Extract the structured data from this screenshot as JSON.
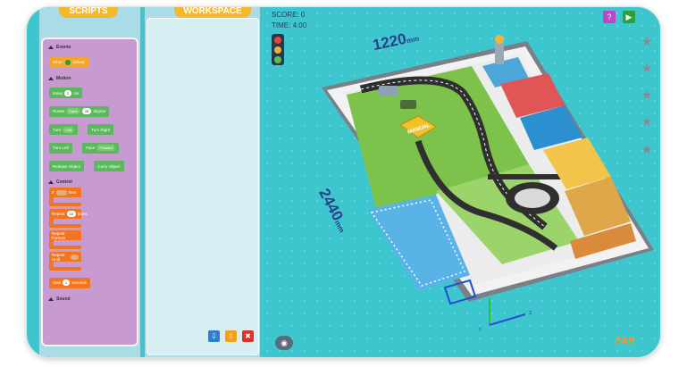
{
  "tabs": {
    "scripts": "SCRIPTS",
    "workspace": "WORKSPACE"
  },
  "palette": {
    "events": {
      "title": "Events",
      "when_clicked": {
        "pre": "When",
        "post": "clicked"
      }
    },
    "motion": {
      "title": "Motion",
      "move": {
        "label": "Move",
        "value": "2",
        "unit": "ms"
      },
      "rotate": {
        "label": "Rotate",
        "dir": "Earth",
        "value": "25",
        "unit": "degree"
      },
      "turn": {
        "label": "Turn",
        "dir": "Left"
      },
      "turn_right": "Turn Right",
      "turn_left": "Turn Left",
      "face": {
        "label": "Face",
        "dir": "Forward"
      },
      "release": "Release Object",
      "carry": "Carry Object"
    },
    "control": {
      "title": "Control",
      "if": {
        "pre": "If",
        "post": "then"
      },
      "repeat": {
        "label": "Repeat",
        "value": "10",
        "unit": "times"
      },
      "repeat_forever": "Repeat Forever",
      "repeat_until": "Repeat Until",
      "wait": {
        "label": "Wait",
        "value": "1",
        "unit": "seconds"
      }
    },
    "sound": {
      "title": "Sound"
    }
  },
  "hud": {
    "score_label": "SCORE:",
    "score": "0",
    "time_label": "TIME:",
    "time": "4:00"
  },
  "board": {
    "width_value": "1220",
    "width_unit": "mm",
    "length_value": "2440",
    "length_unit": "mm",
    "sign": "MANUAL",
    "axis_x": "x",
    "axis_z": "z"
  },
  "brand": "PAR",
  "colors": {
    "bg": "#3ec6cf",
    "panel": "#a9dce6",
    "palette": "#c79bd2",
    "tab": "#f6b82a",
    "events": "#f3a52c",
    "motion": "#5cb85c",
    "control": "#f3761f"
  },
  "icons": [
    "play-icon",
    "help-icon",
    "camera-icon",
    "star-icon",
    "download-icon",
    "upload-icon",
    "trash-icon",
    "traffic-light-icon"
  ]
}
